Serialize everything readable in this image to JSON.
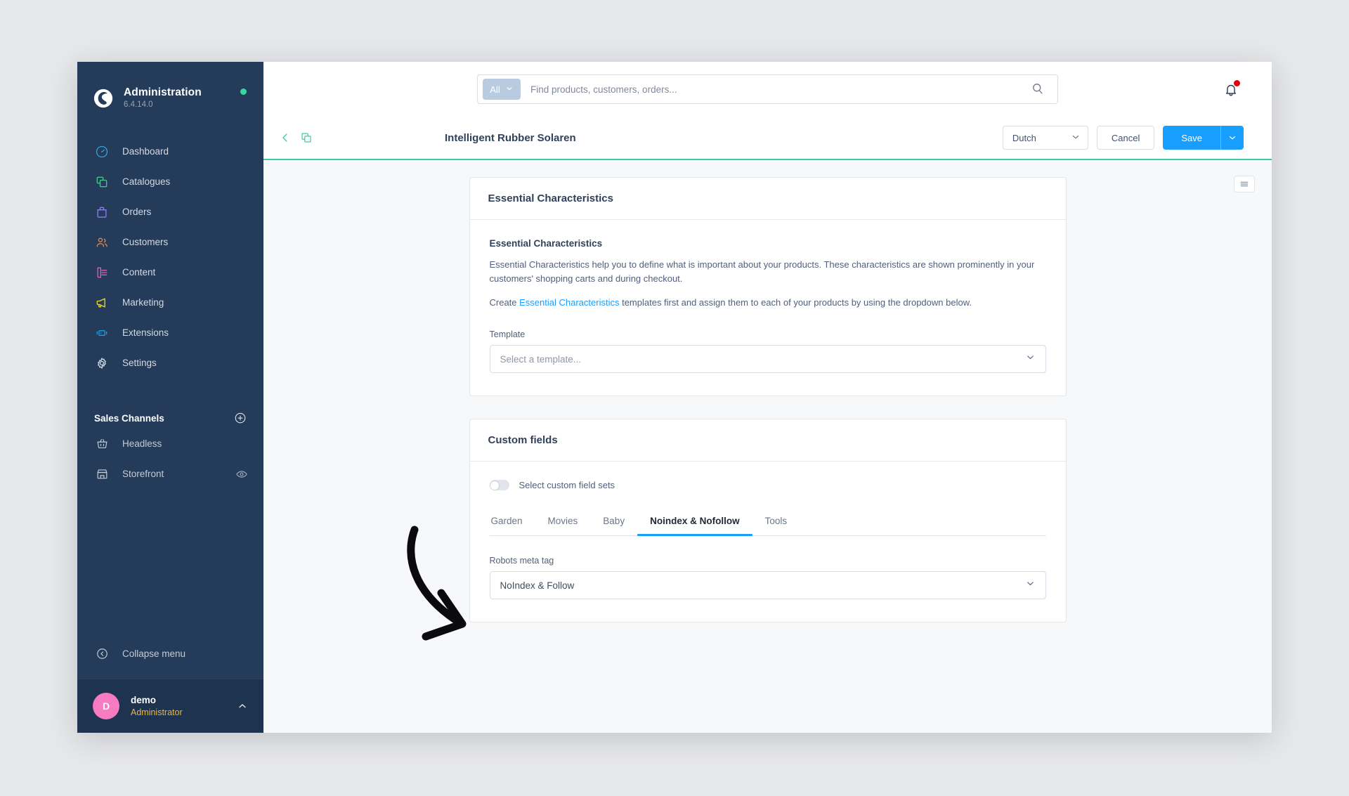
{
  "sidebar": {
    "brand": {
      "title": "Administration",
      "version": "6.4.14.0",
      "logo_icon": "shopware-logo-icon",
      "status_icon": "status-online-dot"
    },
    "items": [
      {
        "label": "Dashboard",
        "icon": "dashboard-gauge-icon",
        "color": "#38a0d8"
      },
      {
        "label": "Catalogues",
        "icon": "catalogues-stack-icon",
        "color": "#4ec08d"
      },
      {
        "label": "Orders",
        "icon": "orders-bag-icon",
        "color": "#8e7ce8"
      },
      {
        "label": "Customers",
        "icon": "customers-people-icon",
        "color": "#e08652"
      },
      {
        "label": "Content",
        "icon": "content-document-icon",
        "color": "#e559b1"
      },
      {
        "label": "Marketing",
        "icon": "marketing-megaphone-icon",
        "color": "#e9d82e"
      },
      {
        "label": "Extensions",
        "icon": "extensions-plug-icon",
        "color": "#1f9bf0"
      },
      {
        "label": "Settings",
        "icon": "settings-gear-icon",
        "color": "#ced6e0"
      }
    ],
    "sales_channels": {
      "title": "Sales Channels",
      "add_icon": "plus-circle-icon",
      "items": [
        {
          "label": "Headless",
          "icon": "basket-icon",
          "trailing_icon": ""
        },
        {
          "label": "Storefront",
          "icon": "storefront-icon",
          "trailing_icon": "eye-icon"
        }
      ]
    },
    "collapse": {
      "label": "Collapse menu",
      "icon": "chevron-left-circle-icon"
    },
    "user": {
      "initial": "D",
      "name": "demo",
      "role": "Administrator",
      "chevron_icon": "chevron-up-icon"
    }
  },
  "topbar": {
    "scope_label": "All",
    "scope_caret_icon": "chevron-down-icon",
    "search_placeholder": "Find products, customers, orders...",
    "search_value": "",
    "search_icon": "search-icon",
    "notifications_icon": "bell-icon"
  },
  "pagehead": {
    "back_icon": "chevron-left-icon",
    "duplicate_icon": "duplicate-icon",
    "title": "Intelligent Rubber Solaren",
    "language": "Dutch",
    "language_caret_icon": "chevron-down-icon",
    "cancel_label": "Cancel",
    "save_label": "Save",
    "save_caret_icon": "chevron-down-icon",
    "accent_color": "#3ccba4"
  },
  "content": {
    "sidebar_toggle_icon": "list-view-icon",
    "essential": {
      "card_title": "Essential Characteristics",
      "sub_title": "Essential Characteristics",
      "paragraph": "Essential Characteristics help you to define what is important about your products. These characteristics are shown prominently in your customers' shopping carts and during checkout.",
      "cta_prefix": "Create ",
      "cta_link": "Essential Characteristics",
      "cta_suffix": " templates first and assign them to each of your products by using the dropdown below.",
      "template_label": "Template",
      "template_placeholder": "Select a template...",
      "template_caret_icon": "chevron-down-icon"
    },
    "custom_fields": {
      "card_title": "Custom fields",
      "toggle_label": "Select custom field sets",
      "toggle_state": "off",
      "tabs": [
        {
          "label": "Garden",
          "active": false
        },
        {
          "label": "Movies",
          "active": false
        },
        {
          "label": "Baby",
          "active": false
        },
        {
          "label": "Noindex & Nofollow",
          "active": true
        },
        {
          "label": "Tools",
          "active": false
        }
      ],
      "field_label": "Robots meta tag",
      "field_value": "NoIndex & Follow",
      "field_caret_icon": "chevron-down-icon",
      "active_tab_color": "#189eff"
    }
  },
  "annotation": {
    "arrow_icon": "curved-arrow-annotation",
    "color": "#0b0b0d"
  }
}
